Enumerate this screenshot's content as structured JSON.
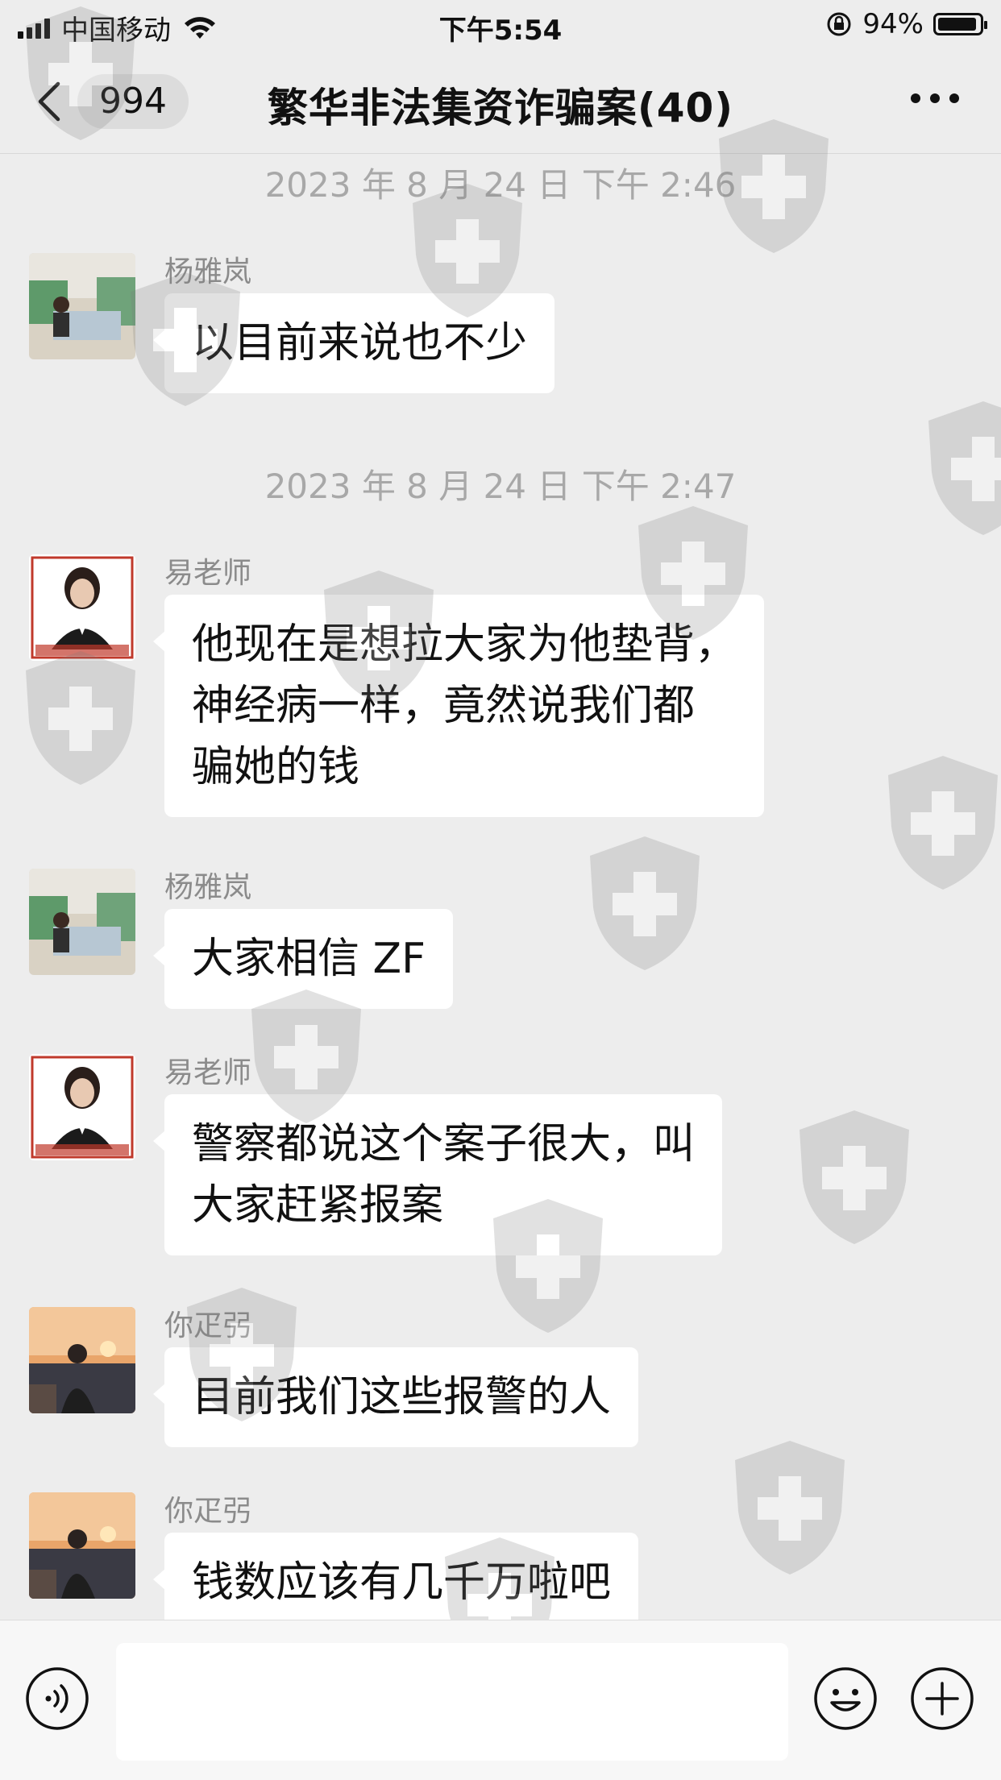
{
  "status_bar": {
    "carrier": "中国移动",
    "time": "下午5:54",
    "battery_percent": "94%",
    "battery_level": 0.94
  },
  "nav": {
    "back_icon": "chevron-left-icon",
    "unread_count": "994",
    "title": "繁华非法集资诈骗案(40)",
    "more_icon": "more-dots-icon"
  },
  "chat": {
    "timestamps": [
      "2023 年 8 月 24 日 下午 2:46",
      "2023 年 8 月 24 日 下午 2:47"
    ],
    "messages": [
      {
        "sender": "杨雅岚",
        "text": "以目前来说也不少"
      },
      {
        "sender": "易老师",
        "text": "他现在是想拉大家为他垫背，\n神经病一样，竟然说我们都\n骗她的钱"
      },
      {
        "sender": "杨雅岚",
        "text": "大家相信 ZF"
      },
      {
        "sender": "易老师",
        "text": "警察都说这个案子很大，叫\n大家赶紧报案"
      },
      {
        "sender": "你疋弜",
        "text": "目前我们这些报警的人"
      },
      {
        "sender": "你疋弜",
        "text": "钱数应该有几千万啦吧"
      }
    ]
  },
  "input_bar": {
    "voice_icon": "voice-icon",
    "input_value": "",
    "emoji_icon": "emoji-icon",
    "plus_icon": "plus-icon"
  },
  "colors": {
    "background": "#ededed",
    "bubble": "#ffffff",
    "timestamp": "#a8a8a8",
    "sender": "#8b8b8b"
  }
}
